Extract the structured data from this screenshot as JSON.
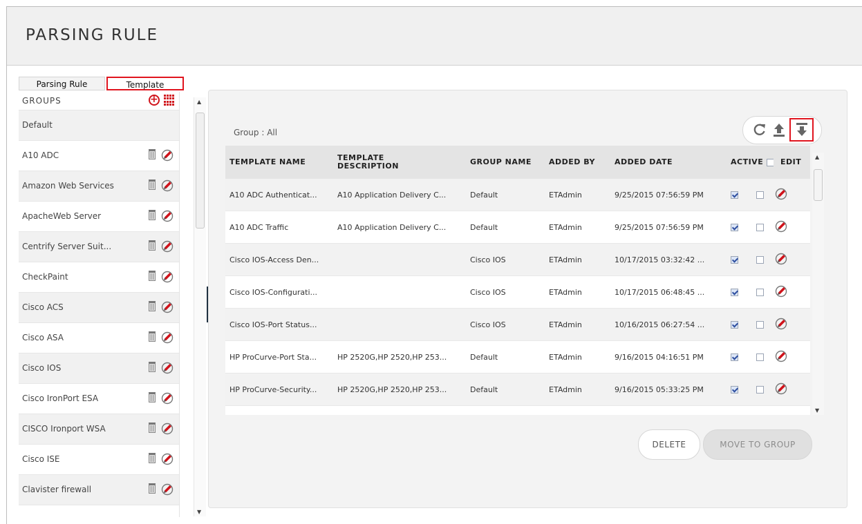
{
  "page": {
    "title": "PARSING RULE"
  },
  "tabs": [
    {
      "label": "Parsing Rule",
      "active": false
    },
    {
      "label": "Template",
      "active": true
    }
  ],
  "groups_panel": {
    "header": "GROUPS",
    "items": [
      "Default",
      "A10 ADC",
      "Amazon Web Services",
      "ApacheWeb Server",
      "Centrify Server Suit...",
      "CheckPaint",
      "Cisco ACS",
      "Cisco ASA",
      "Cisco IOS",
      "Cisco IronPort ESA",
      "CISCO Ironport WSA",
      "Cisco ISE",
      "Clavister firewall",
      ""
    ]
  },
  "main": {
    "group_label": "Group : All",
    "toolbar": {
      "icons": [
        "refresh-icon",
        "upload-icon",
        "download-icon"
      ]
    },
    "table": {
      "columns": [
        "TEMPLATE NAME",
        "TEMPLATE DESCRIPTION",
        "GROUP NAME",
        "ADDED BY",
        "ADDED DATE",
        "ACTIVE",
        "EDIT"
      ],
      "rows": [
        {
          "name": "A10 ADC Authenticat...",
          "description": "A10 Application Delivery C...",
          "group": "Default",
          "added_by": "ETAdmin",
          "added_date": "9/25/2015 07:56:59 PM",
          "active": true,
          "selected": false
        },
        {
          "name": "A10 ADC Traffic",
          "description": "A10 Application Delivery C...",
          "group": "Default",
          "added_by": "ETAdmin",
          "added_date": "9/25/2015 07:56:59 PM",
          "active": true,
          "selected": false
        },
        {
          "name": "Cisco IOS-Access Den...",
          "description": "",
          "group": "Cisco IOS",
          "added_by": "ETAdmin",
          "added_date": "10/17/2015 03:32:42 ...",
          "active": true,
          "selected": false
        },
        {
          "name": "Cisco IOS-Configurati...",
          "description": "",
          "group": "Cisco IOS",
          "added_by": "ETAdmin",
          "added_date": "10/17/2015 06:48:45 ...",
          "active": true,
          "selected": false
        },
        {
          "name": "Cisco IOS-Port Status...",
          "description": "",
          "group": "Cisco IOS",
          "added_by": "ETAdmin",
          "added_date": "10/16/2015 06:27:54 ...",
          "active": true,
          "selected": false
        },
        {
          "name": "HP ProCurve-Port Sta...",
          "description": "HP 2520G,HP 2520,HP 253...",
          "group": "Default",
          "added_by": "ETAdmin",
          "added_date": "9/16/2015 04:16:51 PM",
          "active": true,
          "selected": false
        },
        {
          "name": "HP ProCurve-Security...",
          "description": "HP 2520G,HP 2520,HP 253...",
          "group": "Default",
          "added_by": "ETAdmin",
          "added_date": "9/16/2015 05:33:25 PM",
          "active": true,
          "selected": false
        }
      ]
    },
    "buttons": {
      "delete": "DELETE",
      "move_to_group": "MOVE TO GROUP"
    }
  },
  "colors": {
    "accent": "#d0131b",
    "highlight_box": "#e0141e",
    "header_bg": "#f0f0f0",
    "table_header_bg": "#e4e4e4"
  }
}
